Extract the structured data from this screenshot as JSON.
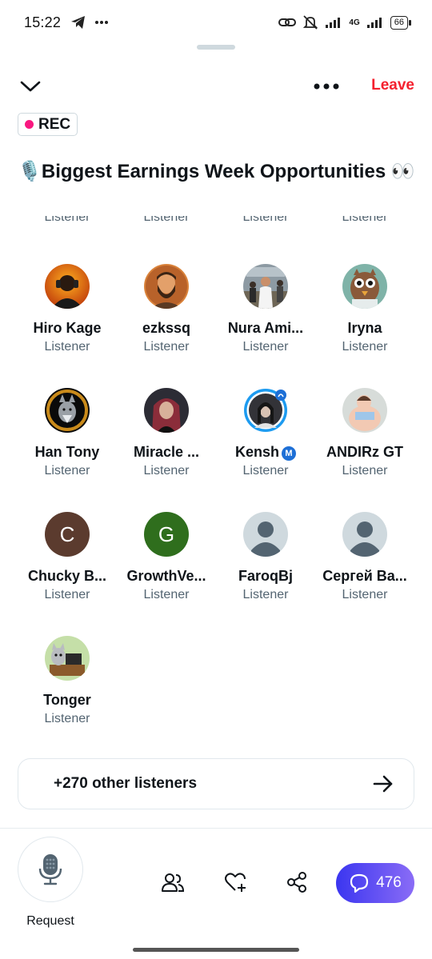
{
  "status_bar": {
    "time": "15:22",
    "network": "4G",
    "battery": "66"
  },
  "header": {
    "leave_label": "Leave"
  },
  "rec_label": "REC",
  "space_title": "🎙️Biggest Earnings Week Opportunities 👀",
  "partial_row_roles": [
    "Listener",
    "Listener",
    "Listener",
    "Listener"
  ],
  "listeners": [
    {
      "name": "Hiro Kage",
      "role": "Listener",
      "avatar": "orange-gradient-hoodie"
    },
    {
      "name": "ezkssq",
      "role": "Listener",
      "avatar": "bearded-man-portrait"
    },
    {
      "name": "Nura Ami...",
      "role": "Listener",
      "avatar": "photo-man-white-robe"
    },
    {
      "name": "Iryna",
      "role": "Listener",
      "avatar": "cartoon-owl"
    },
    {
      "name": "Han Tony",
      "role": "Listener",
      "avatar": "wolf-on-black"
    },
    {
      "name": "Miracle ...",
      "role": "Listener",
      "avatar": "woman-red-hair"
    },
    {
      "name": "Kensh",
      "role": "Listener",
      "avatar": "ringed-woman-portrait",
      "badge": "M"
    },
    {
      "name": "ANDIRz GT",
      "role": "Listener",
      "avatar": "cartoon-figure"
    },
    {
      "name": "Chucky B...",
      "role": "Listener",
      "avatar": "letter",
      "letter": "C",
      "color": "#5b3b2e"
    },
    {
      "name": "GrowthVe...",
      "role": "Listener",
      "avatar": "letter",
      "letter": "G",
      "color": "#2f6e1d"
    },
    {
      "name": "FaroqBj",
      "role": "Listener",
      "avatar": "default-user"
    },
    {
      "name": "Сергей Ва...",
      "role": "Listener",
      "avatar": "default-user"
    },
    {
      "name": "Tonger",
      "role": "Listener",
      "avatar": "cat-at-desk"
    }
  ],
  "others_label": "+270 other listeners",
  "bottom_bar": {
    "request_label": "Request",
    "chat_count": "476"
  },
  "colors": {
    "leave": "#f4212e",
    "rec_dot": "#f91880",
    "chat_start": "#3b36f0",
    "chat_end": "#8a6cf6",
    "subtext": "#536471"
  }
}
